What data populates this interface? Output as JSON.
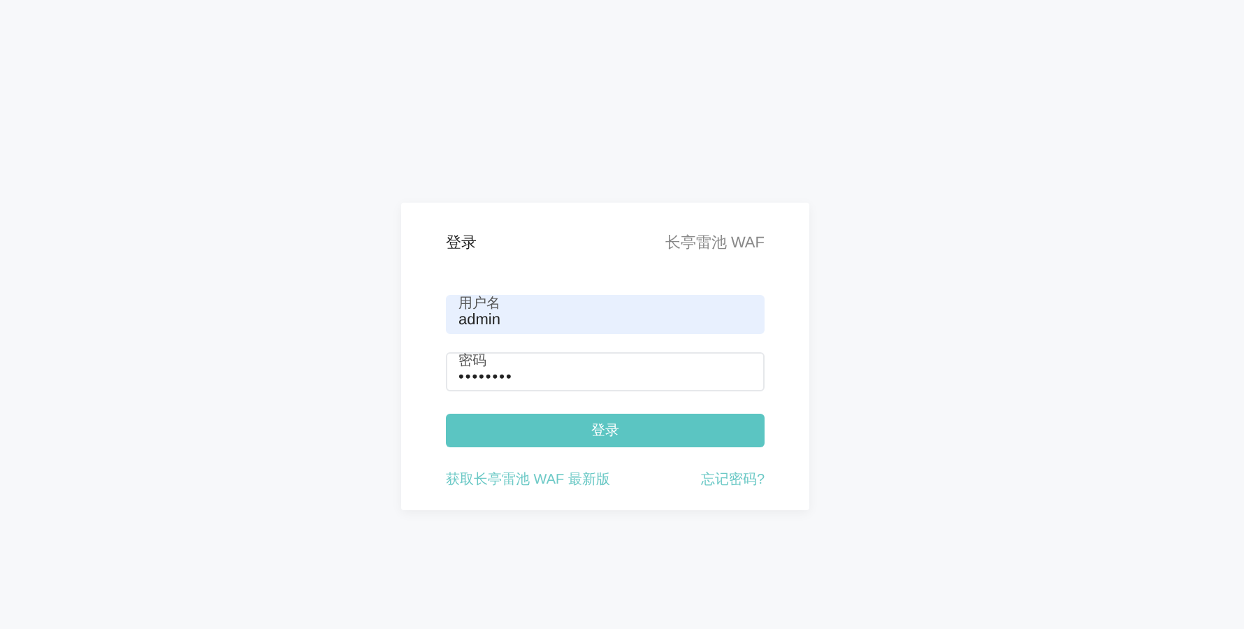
{
  "header": {
    "title": "登录",
    "brand": "长亭雷池 WAF"
  },
  "fields": [
    {
      "kind": "text",
      "label": "用户名",
      "value": "admin",
      "autofilled": true
    },
    {
      "kind": "password",
      "label": "密码",
      "value": "••••••••",
      "autofilled": false
    }
  ],
  "submit": "登录",
  "links": [
    {
      "text": "获取长亭雷池 WAF 最新版"
    },
    {
      "text": "忘记密码?"
    }
  ]
}
